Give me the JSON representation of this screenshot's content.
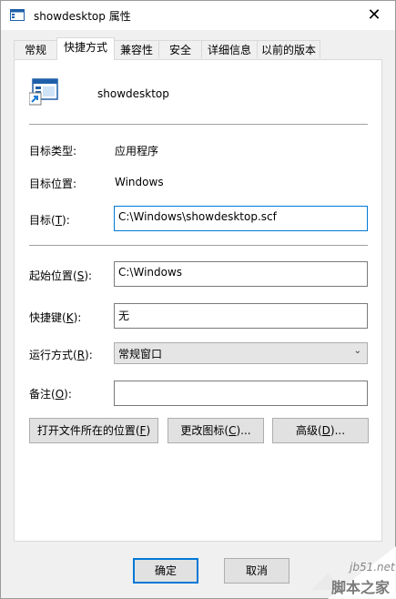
{
  "window": {
    "title": "showdesktop 属性"
  },
  "tabs": [
    {
      "label": "常规"
    },
    {
      "label": "快捷方式"
    },
    {
      "label": "兼容性"
    },
    {
      "label": "安全"
    },
    {
      "label": "详细信息"
    },
    {
      "label": "以前的版本"
    }
  ],
  "shortcut": {
    "name": "showdesktop",
    "target_type_label": "目标类型:",
    "target_type_value": "应用程序",
    "target_location_label": "目标位置:",
    "target_location_value": "Windows",
    "target_label_pre": "目标(",
    "target_label_key": "T",
    "target_label_post": "):",
    "target_value": "C:\\Windows\\showdesktop.scf",
    "start_in_label_pre": "起始位置(",
    "start_in_label_key": "S",
    "start_in_label_post": "):",
    "start_in_value": "C:\\Windows",
    "hotkey_label_pre": "快捷键(",
    "hotkey_label_key": "K",
    "hotkey_label_post": "):",
    "hotkey_value": "无",
    "run_label_pre": "运行方式(",
    "run_label_key": "R",
    "run_label_post": "):",
    "run_value": "常规窗口",
    "comment_label_pre": "备注(",
    "comment_label_key": "O",
    "comment_label_post": "):",
    "comment_value": ""
  },
  "buttons": {
    "open_location_pre": "打开文件所在的位置(",
    "open_location_key": "F",
    "open_location_post": ")",
    "change_icon_pre": "更改图标(",
    "change_icon_key": "C",
    "change_icon_post": ")...",
    "advanced_pre": "高级(",
    "advanced_key": "D",
    "advanced_post": ")...",
    "ok": "确定",
    "cancel": "取消"
  },
  "watermark": {
    "line1": "jb51.net",
    "line2": "脚本之家"
  },
  "colors": {
    "focus_border": "#0078d7",
    "panel_bg": "#ffffff",
    "dialog_bg": "#f0f0f0"
  }
}
